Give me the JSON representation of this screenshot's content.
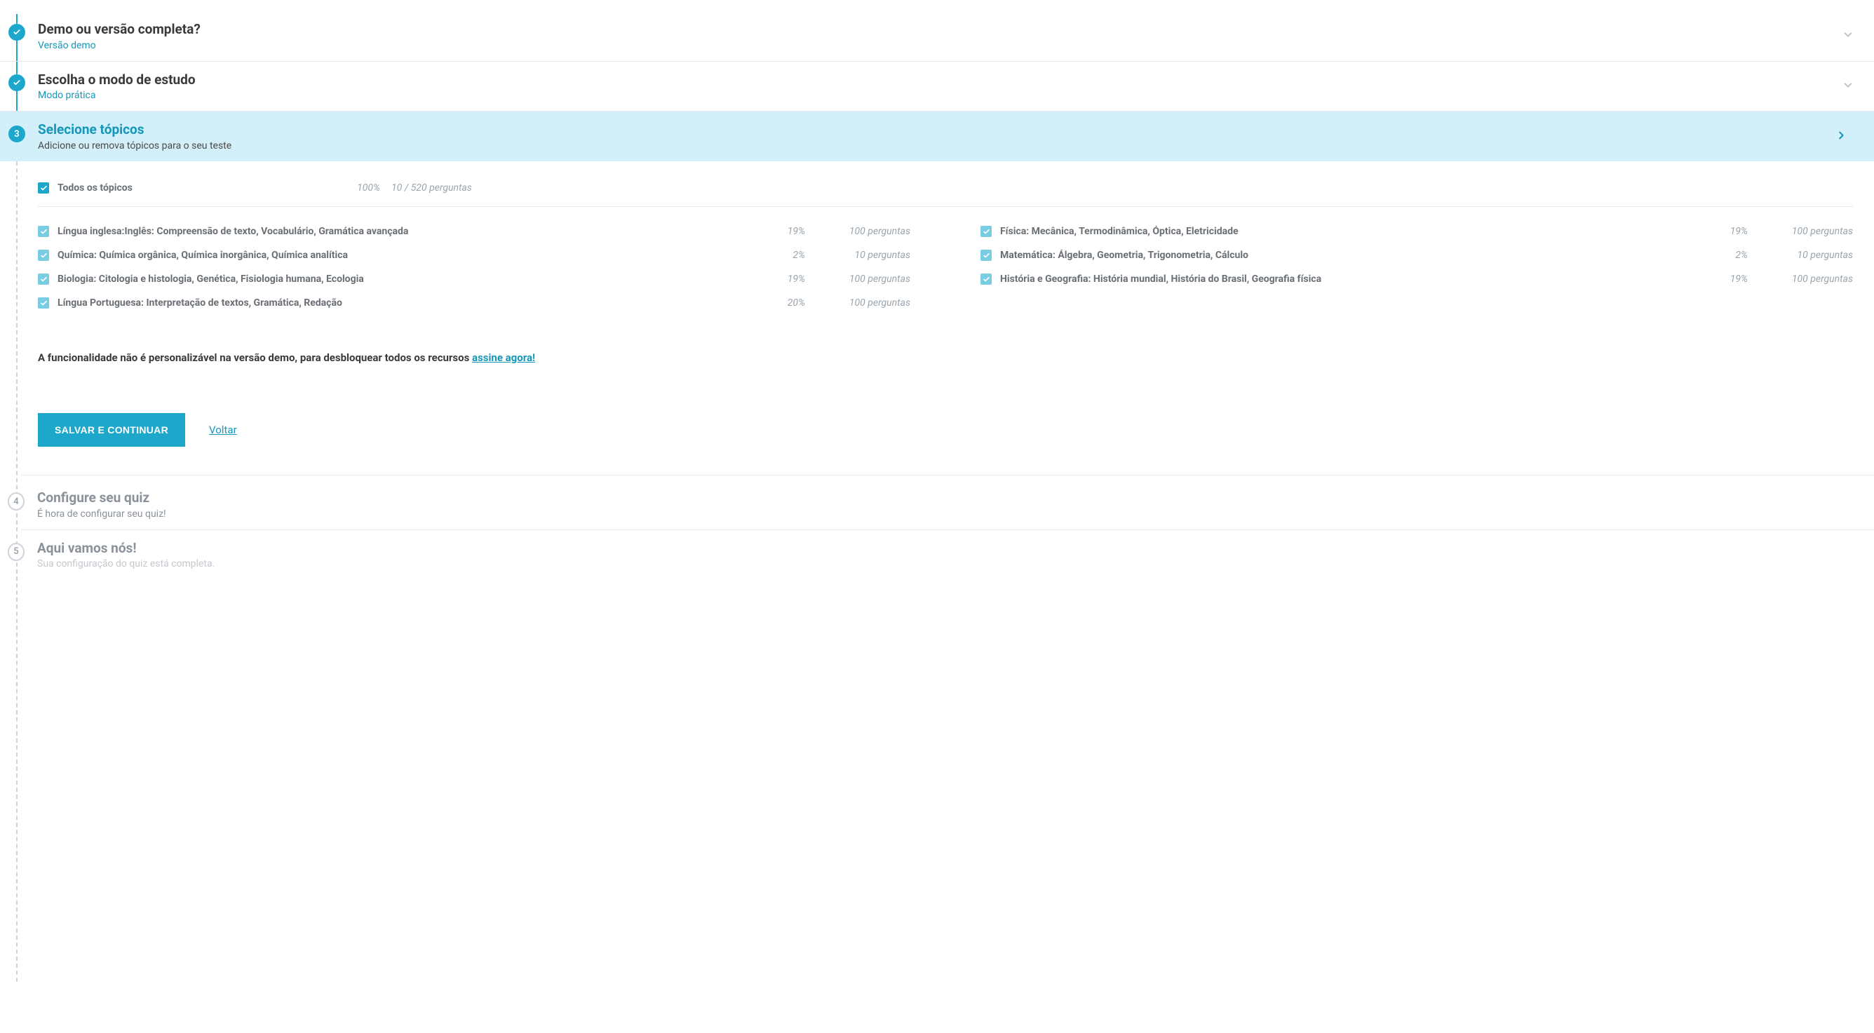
{
  "steps": {
    "s1": {
      "title": "Demo ou versão completa?",
      "sub": "Versão demo"
    },
    "s2": {
      "title": "Escolha o modo de estudo",
      "sub": "Modo prática"
    },
    "s3": {
      "title": "Selecione tópicos",
      "sub": "Adicione ou remova tópicos para o seu teste",
      "number": "3"
    },
    "s4": {
      "title": "Configure seu quiz",
      "sub": "É hora de configurar seu quiz!",
      "number": "4"
    },
    "s5": {
      "title": "Aqui vamos nós!",
      "sub": "Sua configuração do quiz está completa.",
      "number": "5"
    }
  },
  "all_topics": {
    "label": "Todos os tópicos",
    "pct": "100%",
    "questions": "10 / 520 perguntas"
  },
  "topics": [
    {
      "label": "Língua inglesa:Inglês: Compreensão de texto, Vocabulário, Gramática avançada",
      "pct": "19%",
      "questions": "100 perguntas"
    },
    {
      "label": "Física: Mecânica, Termodinâmica, Óptica, Eletricidade",
      "pct": "19%",
      "questions": "100 perguntas"
    },
    {
      "label": "Química: Química orgânica, Química inorgânica, Química analítica",
      "pct": "2%",
      "questions": "10 perguntas"
    },
    {
      "label": "Matemática: Álgebra, Geometria, Trigonometria, Cálculo",
      "pct": "2%",
      "questions": "10 perguntas"
    },
    {
      "label": "Biologia: Citologia e histologia, Genética, Fisiologia humana, Ecologia",
      "pct": "19%",
      "questions": "100 perguntas"
    },
    {
      "label": "História e Geografia: História mundial, História do Brasil, Geografia física",
      "pct": "19%",
      "questions": "100 perguntas"
    },
    {
      "label": "Língua Portuguesa: Interpretação de textos, Gramática, Redação",
      "pct": "20%",
      "questions": "100 perguntas"
    }
  ],
  "demo_note": {
    "text": "A funcionalidade não é personalizável na versão demo, para desbloquear todos os recursos ",
    "link": "assine agora!"
  },
  "actions": {
    "save": "SALVAR E CONTINUAR",
    "back": "Voltar"
  }
}
